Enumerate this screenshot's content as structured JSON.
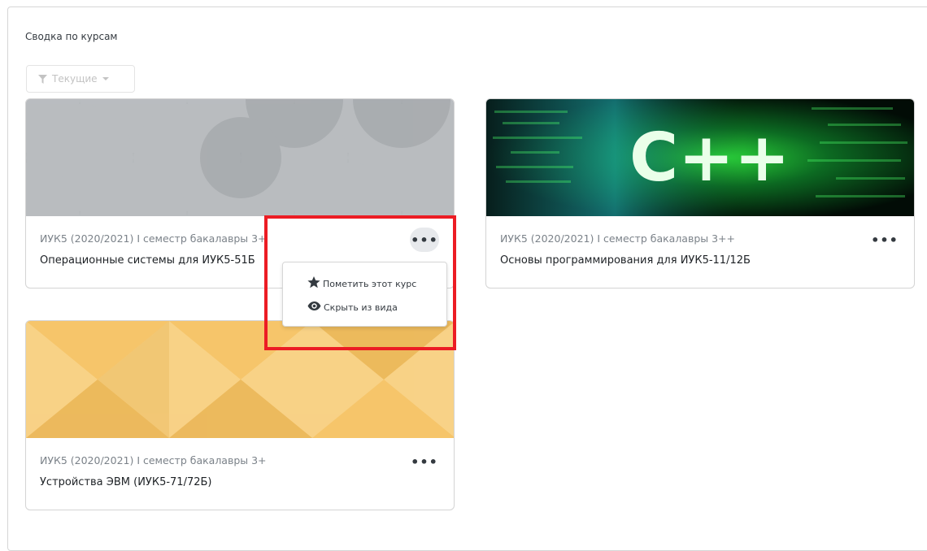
{
  "section": {
    "title": "Сводка по курсам"
  },
  "filter": {
    "label": "Текущие",
    "icon": "filter-icon"
  },
  "courses": [
    {
      "meta": "ИУК5 (2020/2021) I семестр бакалавры 3+",
      "title": "Операционные системы для ИУК5-51Б",
      "image": "grey-circle-pattern"
    },
    {
      "meta": "ИУК5 (2020/2021) I семестр бакалавры 3++",
      "title": "Основы программирования для ИУК5-11/12Б",
      "image": "cpp-code-image"
    },
    {
      "meta": "ИУК5 (2020/2021) I семестр бакалавры 3+",
      "title": "Устройства ЭВМ (ИУК5-71/72Б)",
      "image": "yellow-triangle-pattern"
    }
  ],
  "menu": {
    "star_label": "Пометить этот курс",
    "hide_label": "Скрыть из вида"
  },
  "more_label": "•••",
  "cpp_text": "C++",
  "colors": {
    "highlight": "#ec1c24",
    "grey_pattern": "#a9adb0",
    "yellow_pattern": "#f6c56a"
  }
}
